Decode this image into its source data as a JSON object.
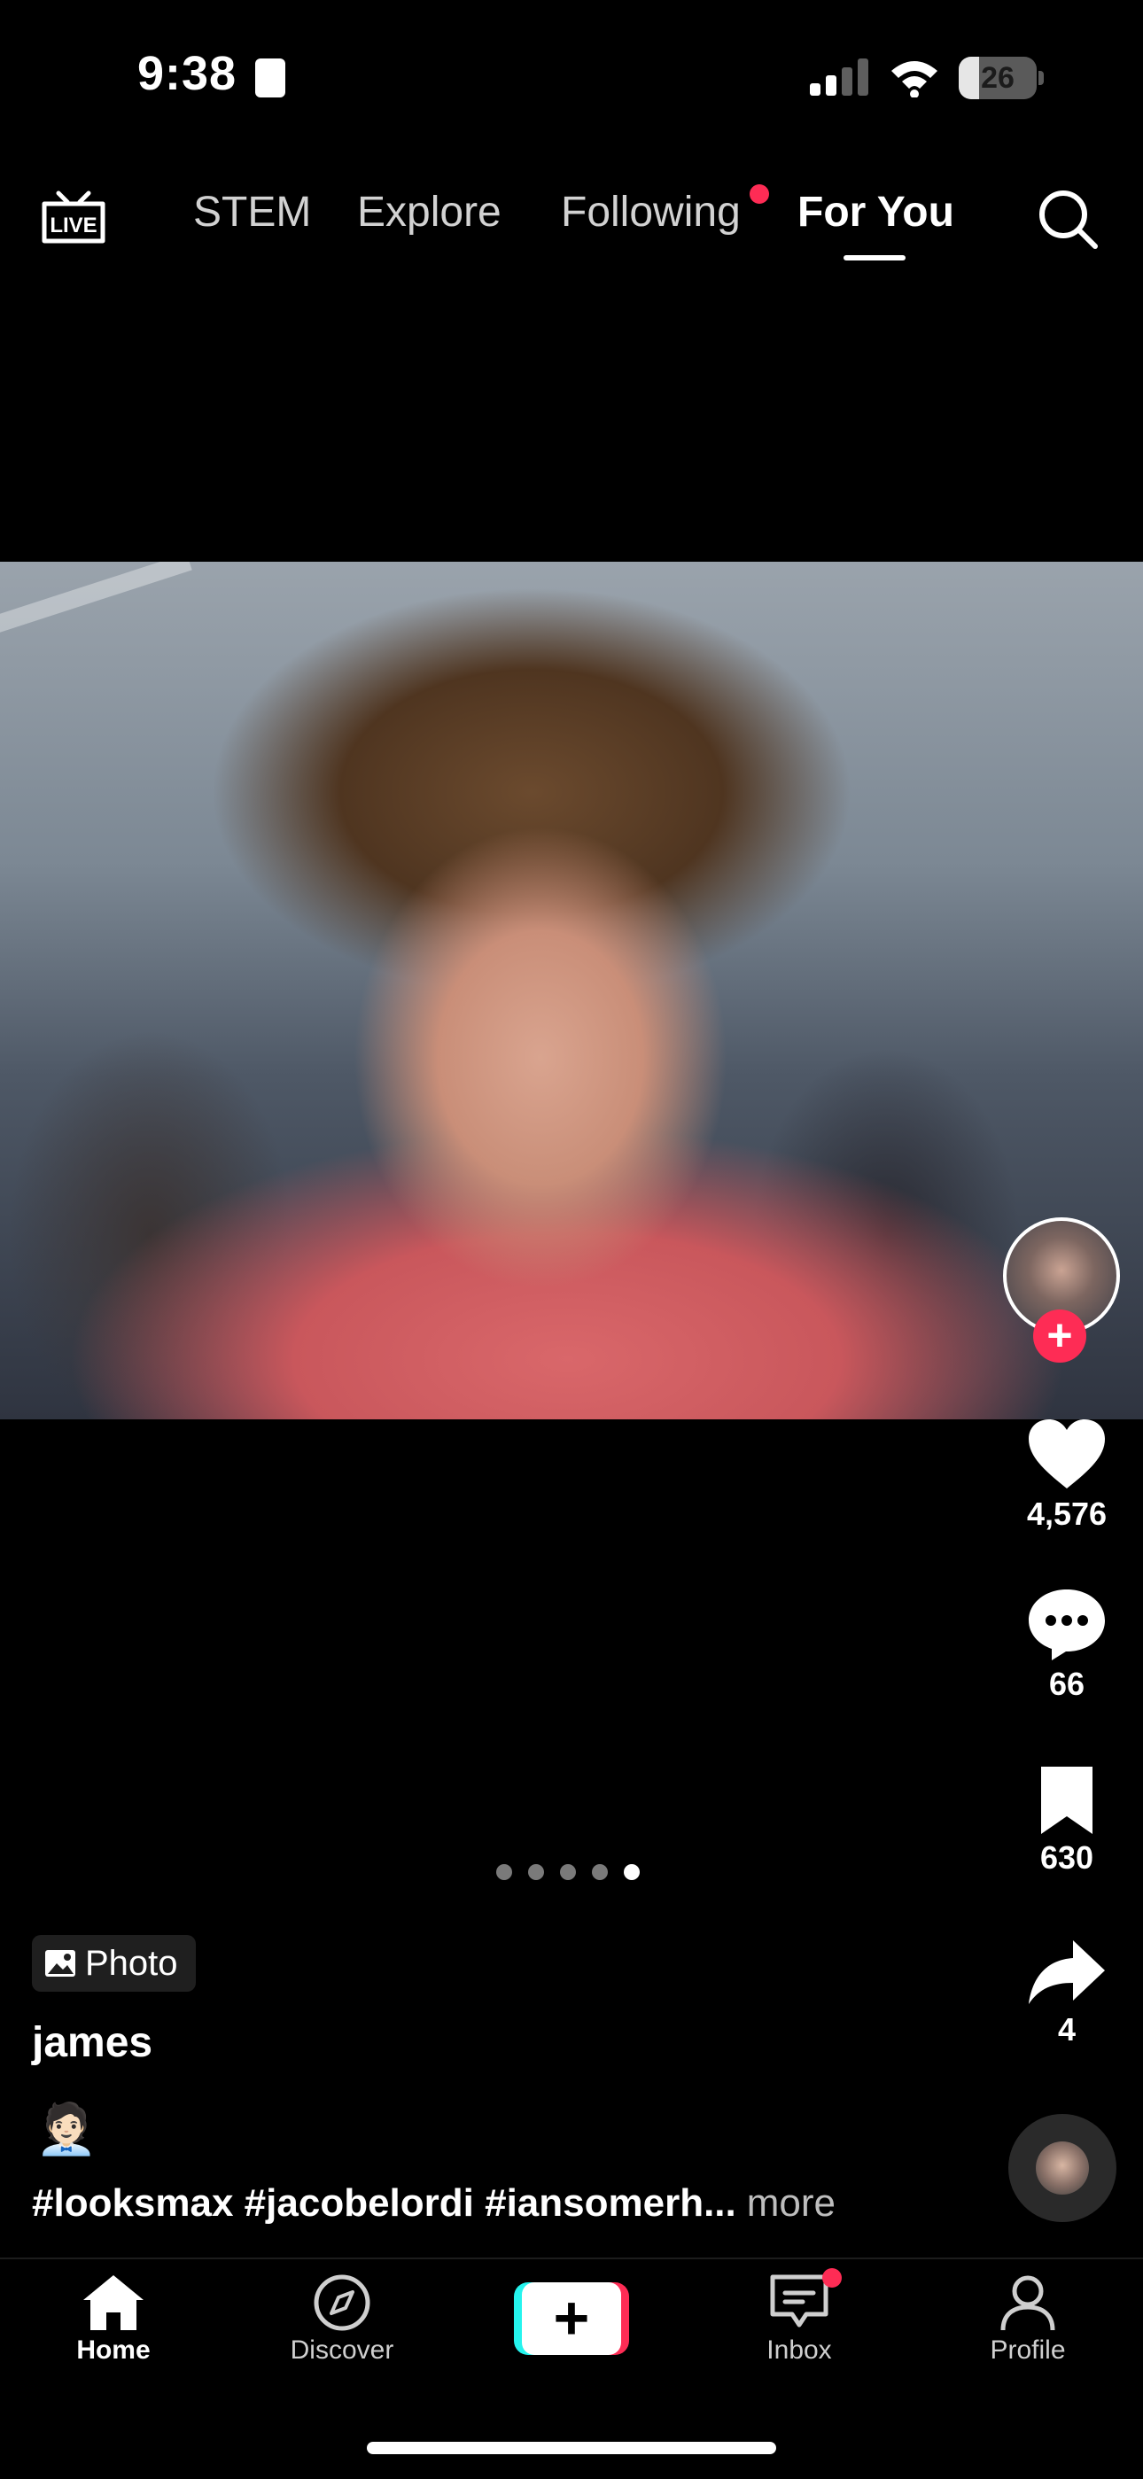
{
  "status_bar": {
    "time": "9:38",
    "battery_level": "26",
    "battery_fraction": 0.26
  },
  "top_nav": {
    "live_label": "LIVE",
    "tabs": [
      {
        "label": "STEM",
        "active": false
      },
      {
        "label": "Explore",
        "active": false
      },
      {
        "label": "Following",
        "active": false,
        "has_dot": true
      },
      {
        "label": "For You",
        "active": true
      }
    ]
  },
  "post": {
    "type_label": "Photo",
    "username": "james",
    "emoji": "🧑🏻‍💼",
    "hashtags": "#looksmax #jacobelordi #iansomerh...",
    "more_label": "more",
    "page_count": 5,
    "current_page": 5
  },
  "actions": {
    "likes": "4,576",
    "comments": "66",
    "saves": "630",
    "shares": "4"
  },
  "bottom_nav": {
    "home": "Home",
    "discover": "Discover",
    "create": "+",
    "inbox": "Inbox",
    "profile": "Profile"
  },
  "colors": {
    "accent_red": "#fe2c55",
    "accent_cyan": "#25f4ee",
    "background": "#000000"
  }
}
